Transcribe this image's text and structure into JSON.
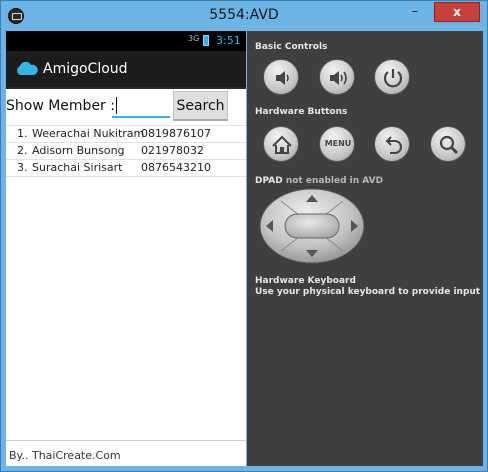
{
  "window": {
    "title": "5554:AVD",
    "minimize": "–",
    "maximize": "□",
    "close": "x"
  },
  "status_bar": {
    "signal": "3G",
    "time": "3:51"
  },
  "app": {
    "name": "AmigoCloud",
    "icon": "cloud-icon"
  },
  "search": {
    "label": "Show Member :",
    "value": "",
    "button": "Search"
  },
  "members": [
    {
      "index": "1.",
      "name": "Weerachai Nukitram",
      "phone": "0819876107"
    },
    {
      "index": "2.",
      "name": "Adisorn Bunsong",
      "phone": "021978032"
    },
    {
      "index": "3.",
      "name": "Surachai Sirisart",
      "phone": "0876543210"
    }
  ],
  "footer": "By.. ThaiCreate.Com",
  "controls": {
    "basic_title": "Basic Controls",
    "hardware_title": "Hardware Buttons",
    "menu_label": "MENU",
    "dpad_title": "DPAD",
    "dpad_note": "not enabled in AVD",
    "keyboard_title": "Hardware Keyboard",
    "keyboard_note": "Use your physical keyboard to provide input"
  },
  "colors": {
    "accent": "#33b5e5",
    "panel": "#3f3f3f",
    "close": "#c7403a"
  }
}
